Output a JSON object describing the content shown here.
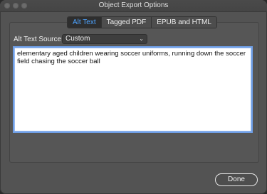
{
  "window": {
    "title": "Object Export Options"
  },
  "tabs": [
    {
      "label": "Alt Text",
      "active": true
    },
    {
      "label": "Tagged PDF",
      "active": false
    },
    {
      "label": "EPUB and HTML",
      "active": false
    }
  ],
  "alt_text": {
    "source_label": "Alt Text Source:",
    "source_value": "Custom",
    "text": "elementary aged children wearing soccer uniforms, running down the soccer field chasing the soccer ball"
  },
  "footer": {
    "done_label": "Done"
  },
  "colors": {
    "active_tab_text": "#4da3ff",
    "focus_ring": "#6f9fe6"
  },
  "icons": {
    "close": "window-close-icon",
    "minimize": "window-minimize-icon",
    "zoom": "window-zoom-icon",
    "dropdown": "chevron-down-icon"
  }
}
